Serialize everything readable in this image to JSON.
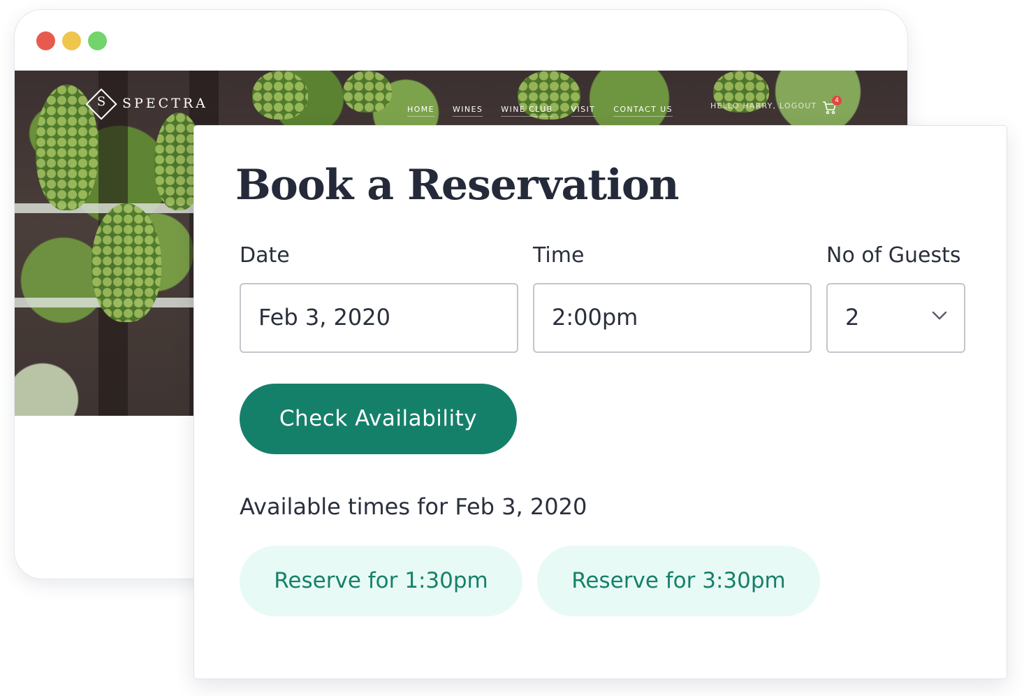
{
  "window": {
    "traffic_lights": [
      {
        "name": "close",
        "color": "#e85a4f"
      },
      {
        "name": "minimize",
        "color": "#eec54d"
      },
      {
        "name": "maximize",
        "color": "#72d46a"
      }
    ]
  },
  "site": {
    "logo_letter": "S",
    "logo_text": "SPECTRA",
    "nav": [
      "HOME",
      "WINES",
      "WINE CLUB",
      "VISIT",
      "CONTACT US"
    ],
    "greeting": "HELLO HARRY, LOGOUT",
    "cart_icon": "shopping-cart-icon",
    "cart_count": "4"
  },
  "reservation": {
    "title": "Book a Reservation",
    "date_label": "Date",
    "date_value": "Feb 3, 2020",
    "time_label": "Time",
    "time_value": "2:00pm",
    "guests_label": "No of Guests",
    "guests_value": "2",
    "guests_icon": "chevron-down-icon",
    "check_button": "Check Availability",
    "available_heading": "Available times for Feb 3, 2020",
    "slots": [
      "Reserve for 1:30pm",
      "Reserve for 3:30pm"
    ]
  },
  "colors": {
    "primary": "#15806a",
    "slot_background": "#e8faf5",
    "heading_text": "#252a3a",
    "body_text": "#2a2f3d",
    "badge": "#e2473f"
  }
}
